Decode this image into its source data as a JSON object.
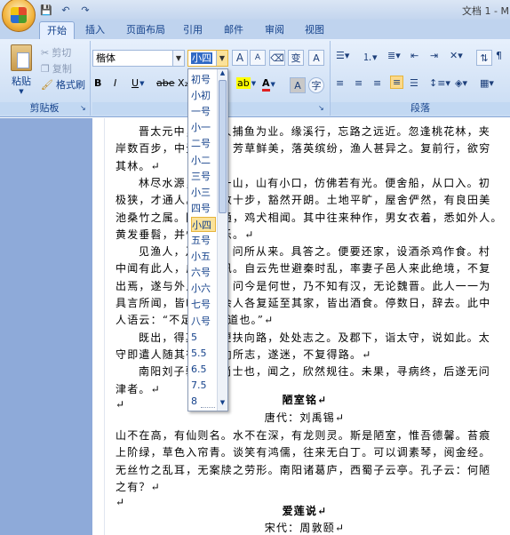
{
  "window": {
    "title": "文档 1 - M"
  },
  "qat": {
    "save": "💾",
    "undo": "↶",
    "redo": "↷"
  },
  "tabs": [
    "开始",
    "插入",
    "页面布局",
    "引用",
    "邮件",
    "审阅",
    "视图"
  ],
  "clipboard": {
    "paste": "粘贴",
    "cut": "剪切",
    "copy": "复制",
    "format_painter": "格式刷",
    "group": "剪贴板"
  },
  "font": {
    "family": "楷体",
    "size": "小四",
    "grow": "A",
    "shrink": "A",
    "bold": "B",
    "italic": "I",
    "underline": "U",
    "strike": "abe",
    "subscript": "X₂",
    "font_color": "A",
    "highlight": "ab",
    "pinyin": "变",
    "charborder": "A",
    "charshade": "A",
    "enclose": "字"
  },
  "paragraph": {
    "group": "段落"
  },
  "size_options": [
    "初号",
    "小初",
    "一号",
    "小一",
    "二号",
    "小二",
    "三号",
    "小三",
    "四号",
    "小四",
    "五号",
    "小五",
    "六号",
    "小六",
    "七号",
    "八号",
    "5",
    "5.5",
    "6.5",
    "7.5",
    "8"
  ],
  "size_selected": "小四",
  "document": {
    "lines": [
      "晋太元中，武陵人捕鱼为业。缘溪行，忘路之远近。忽逢桃花林，夹",
      "岸数百步，中无杂树，芳草鲜美，落英缤纷，渔人甚异之。复前行，欲穷",
      "其林。↵",
      "林尽水源，便得一山，山有小口，仿佛若有光。便舍船，从口入。初",
      "极狭，才通人。复行数十步，豁然开朗。土地平旷，屋舍俨然，有良田美",
      "池桑竹之属。阡陌交通，鸡犬相闻。其中往来种作，男女衣着，悉如外人。",
      "黄发垂髫，并怡然自乐。↵",
      "见渔人，乃大惊，问所从来。具答之。便要还家，设酒杀鸡作食。村",
      "中闻有此人，咸来问讯。自云先世避秦时乱，率妻子邑人来此绝境，不复",
      "出焉，遂与外人间隔。问今是何世，乃不知有汉，无论魏晋。此人一一为",
      "具言所闻，皆叹惋。余人各复延至其家，皆出酒食。停数日，辞去。此中",
      "人语云：“不足为外人道也。”↵",
      "既出，得其船，便扶向路，处处志之。及郡下，诣太守，说如此。太",
      "守即遣人随其往，寻向所志，遂迷，不复得路。↵",
      "南阳刘子骥，高尚士也，闻之，欣然规往。未果，寻病终，后遂无问",
      "津者。↵",
      "↵"
    ],
    "title2": "陋室铭↵",
    "author2": "唐代：刘禹锡↵",
    "lines2": [
      "山不在高，有仙则名。水不在深，有龙则灵。斯是陋室，惟吾德馨。苔痕",
      "上阶绿，草色入帘青。谈笑有鸿儒，往来无白丁。可以调素琴，阅金经。",
      "无丝竹之乱耳，无案牍之劳形。南阳诸葛庐，西蜀子云亭。孔子云：何陋",
      "之有？↵",
      "↵"
    ],
    "title3": "爱莲说↵",
    "author3": "宋代：周敦颐↵"
  }
}
